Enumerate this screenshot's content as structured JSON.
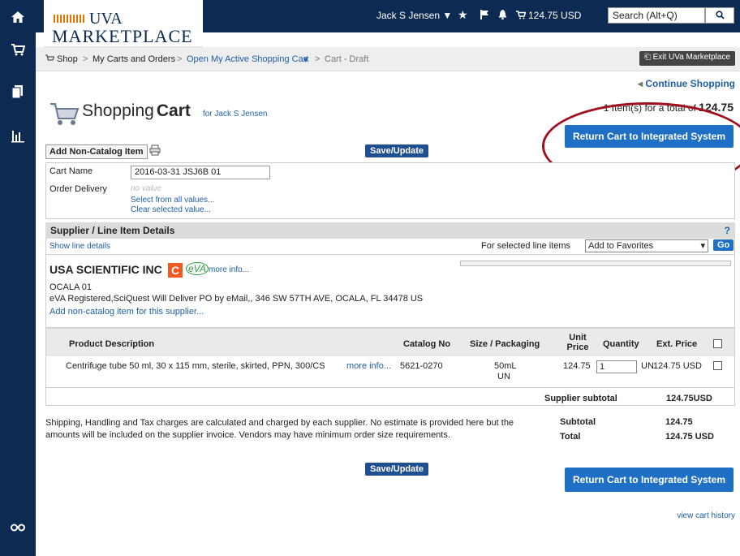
{
  "nav": {
    "icons": [
      "home-icon",
      "cart-icon",
      "documents-icon",
      "reports-icon",
      "binoculars-icon"
    ]
  },
  "header": {
    "logo_top": "UVA",
    "logo_bottom": "MARKETPLACE",
    "user": "Jack S Jensen ▼",
    "cart_total": "124.75 USD",
    "search_placeholder": "Search (Alt+Q)"
  },
  "breadcrumb": {
    "items": [
      "Shop",
      "My Carts and Orders",
      "Open My Active Shopping Cart",
      "Cart - Draft"
    ],
    "exit_label": "Exit UVa Marketplace"
  },
  "cart": {
    "continue_shopping": "Continue Shopping",
    "title_light": "Shopping",
    "title_bold": "Cart",
    "for_user": "for Jack S Jensen",
    "summary_prefix": "1 Item(s)  for a total of",
    "summary_total": "124.75",
    "return_label": "Return Cart to Integrated System",
    "add_noncatalog_label": "Add Non-Catalog Item",
    "save_label": "Save/Update",
    "cart_name_label": "Cart Name",
    "cart_name_value": "2016-03-31 JSJ6B 01",
    "order_delivery_label": "Order Delivery",
    "order_delivery_value": "no value",
    "select_all_values": "Select from all values...",
    "clear_value": "Clear selected value..."
  },
  "supplier_section": {
    "title": "Supplier / Line Item Details",
    "help": "?",
    "show_line_details": "Show line details",
    "for_selected": "For selected line items",
    "action_selected": "Add to Favorites",
    "go_label": "Go",
    "supplier_name": "USA SCIENTIFIC INC",
    "badge_c": "C",
    "badge_eva": "eVA",
    "more_info": "more info...",
    "location": "OCALA 01",
    "address": "eVA Registered,SciQuest Will Deliver PO by eMail,, 346 SW 57TH AVE, OCALA, FL 34478 US",
    "add_item_link": "Add non-catalog item for this supplier..."
  },
  "line_items": {
    "columns": [
      "Product Description",
      "Catalog No",
      "Size / Packaging",
      "Unit Price",
      "Quantity",
      "Ext. Price"
    ],
    "rows": [
      {
        "description": "Centrifuge tube 50 ml, 30 x 115 mm, sterile, skirted, PPN, 300/CS",
        "more_info": "more info...",
        "catalog_no": "5621-0270",
        "size": "50mL",
        "packaging": "UN",
        "unit_price": "124.75",
        "quantity": "1",
        "unit": "UN",
        "ext_price": "124.75 USD"
      }
    ],
    "supplier_subtotal_label": "Supplier subtotal",
    "supplier_subtotal_value": "124.75USD"
  },
  "totals": {
    "note": "Shipping, Handling and Tax charges are calculated and charged by each supplier. No estimate is provided here but the amounts will be included on the supplier invoice. Vendors may have minimum order size requirements.",
    "subtotal_label": "Subtotal",
    "subtotal_value": "124.75",
    "total_label": "Total",
    "total_value": "124.75 USD"
  },
  "footer": {
    "history_link": "view cart history"
  }
}
